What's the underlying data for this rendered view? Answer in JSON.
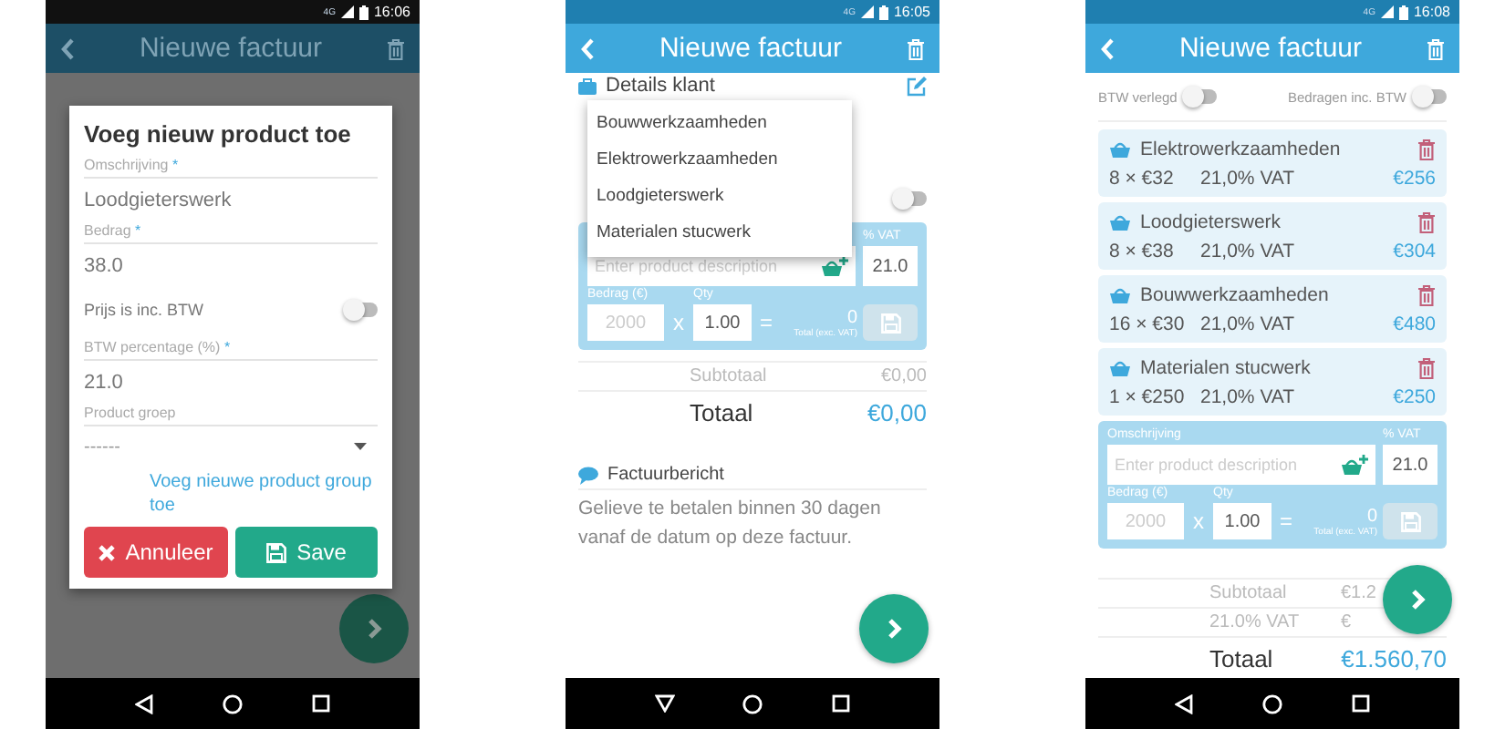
{
  "screen_1": {
    "status_bar": {
      "network": "4G",
      "time": "16:06"
    },
    "title": "Nieuwe factuur",
    "keyboard_open": false,
    "dialog": {
      "title": "Voeg nieuw product toe",
      "fields": [
        {
          "kind": "text",
          "label": "Omschrijving",
          "mark": "*",
          "value": "Loodgieterswerk"
        },
        {
          "kind": "text",
          "label": "Bedrag",
          "mark": "*",
          "value": "38.0"
        },
        {
          "kind": "switch",
          "label": "Prijs is inc. BTW",
          "on": false
        },
        {
          "kind": "text",
          "label": "BTW percentage (%)",
          "mark": "*",
          "value": "21.0"
        },
        {
          "kind": "select",
          "label": "Product groep",
          "value": "------"
        }
      ],
      "link": "Voeg nieuwe product group toe",
      "buttons": [
        {
          "kind": "cancel",
          "label": "Annuleer"
        },
        {
          "kind": "save",
          "label": "Save"
        }
      ]
    }
  },
  "screen_2": {
    "status_bar": {
      "network": "4G",
      "time": "16:05"
    },
    "title": "Nieuwe factuur",
    "keyboard_open": true,
    "section": "Details klant",
    "menu": [
      "Bouwwerkzaamheden",
      "Elektrowerkzaamheden",
      "Loodgieterswerk",
      "Materialen stucwerk"
    ],
    "switch": {
      "on": false
    },
    "entry": {
      "vat_label": "% VAT",
      "placeholder": "Enter product description",
      "vat": "21.0",
      "amount_label": "Bedrag (€)",
      "qty_label": "Qty",
      "amount_placeholder": "2000",
      "times": "x",
      "qty": "1.00",
      "equals": "=",
      "total": "0",
      "total_label": "Total (exc. VAT)",
      "save_disabled": true
    },
    "totals": [
      {
        "kind": "sub",
        "label": "Subtotaal",
        "value": "€0,00"
      },
      {
        "kind": "grand",
        "label": "Totaal",
        "value": "€0,00"
      }
    ],
    "message": {
      "title": "Factuurbericht",
      "text": "Gelieve te betalen binnen 30 dagen vanaf de datum op deze factuur."
    }
  },
  "screen_3": {
    "status_bar": {
      "network": "4G",
      "time": "16:08"
    },
    "title": "Nieuwe factuur",
    "keyboard_open": false,
    "switches": [
      {
        "label": "BTW verlegd",
        "on": false
      },
      {
        "label": "Bedragen inc. BTW",
        "on": false
      }
    ],
    "products": [
      {
        "name": "Elektrowerkzaamheden",
        "amount": "8 × €32",
        "vat": "21,0% VAT",
        "total": "€256"
      },
      {
        "name": "Loodgieterswerk",
        "amount": "8 × €38",
        "vat": "21,0% VAT",
        "total": "€304"
      },
      {
        "name": "Bouwwerkzaamheden",
        "amount": "16 × €30",
        "vat": "21,0% VAT",
        "total": "€480"
      },
      {
        "name": "Materialen stucwerk",
        "amount": "1 × €250",
        "vat": "21,0% VAT",
        "total": "€250"
      }
    ],
    "entry": {
      "description_label": "Omschrijving",
      "vat_label": "% VAT",
      "placeholder": "Enter product description",
      "vat": "21.0",
      "amount_label": "Bedrag (€)",
      "qty_label": "Qty",
      "amount_placeholder": "2000",
      "times": "x",
      "qty": "1.00",
      "equals": "=",
      "total": "0",
      "total_label": "Total (exc. VAT)",
      "save_disabled": true
    },
    "totals": [
      {
        "kind": "sub",
        "label": "Subtotaal",
        "value": "€1.2"
      },
      {
        "kind": "sub",
        "label": "21.0% VAT",
        "value": "€"
      },
      {
        "kind": "grand",
        "label": "Totaal",
        "value": "€1.560,70"
      }
    ]
  }
}
